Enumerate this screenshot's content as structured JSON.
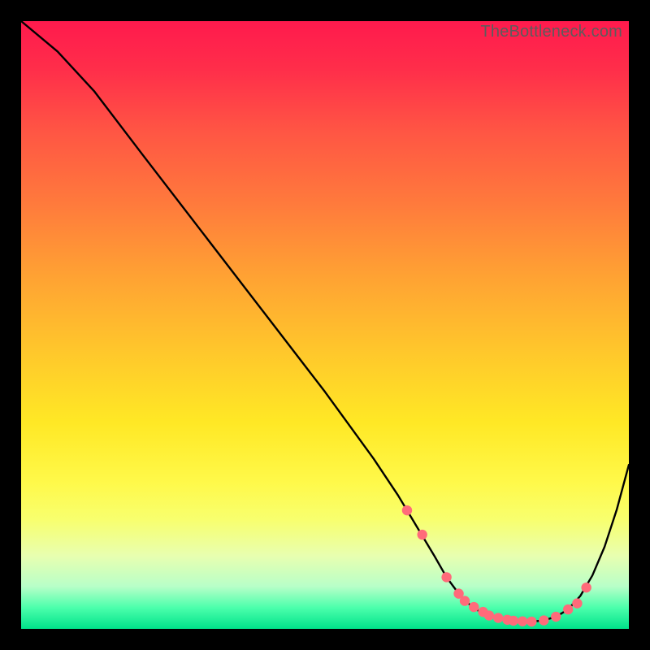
{
  "watermark": "TheBottleneck.com",
  "colors": {
    "marker": "#ff6b7a",
    "curve": "#000000"
  },
  "chart_data": {
    "type": "line",
    "title": "",
    "xlabel": "",
    "ylabel": "",
    "xlim": [
      0,
      100
    ],
    "ylim": [
      0,
      100
    ],
    "grid": false,
    "legend": false,
    "series": [
      {
        "name": "bottleneck-curve",
        "x": [
          0,
          6,
          12,
          20,
          30,
          40,
          50,
          58,
          62,
          65,
          68,
          70,
          72,
          74,
          76,
          78,
          80,
          82,
          84,
          86,
          88,
          90,
          92,
          94,
          96,
          98,
          100
        ],
        "y": [
          100,
          95,
          88.5,
          78,
          65,
          52,
          39,
          28,
          22,
          17,
          12,
          8.5,
          5.8,
          3.8,
          2.5,
          1.8,
          1.4,
          1.2,
          1.2,
          1.4,
          2.0,
          3.2,
          5.4,
          8.8,
          13.5,
          19.6,
          27
        ]
      }
    ],
    "markers": {
      "name": "highlighted-points",
      "x": [
        63.5,
        66,
        70,
        72,
        73,
        74.5,
        76,
        77,
        78.5,
        80,
        81,
        82.5,
        84,
        86,
        88,
        90,
        91.5,
        93
      ],
      "y": [
        19.5,
        15.5,
        8.5,
        5.8,
        4.6,
        3.6,
        2.8,
        2.2,
        1.8,
        1.5,
        1.35,
        1.25,
        1.2,
        1.4,
        2.0,
        3.2,
        4.2,
        6.8
      ]
    }
  }
}
